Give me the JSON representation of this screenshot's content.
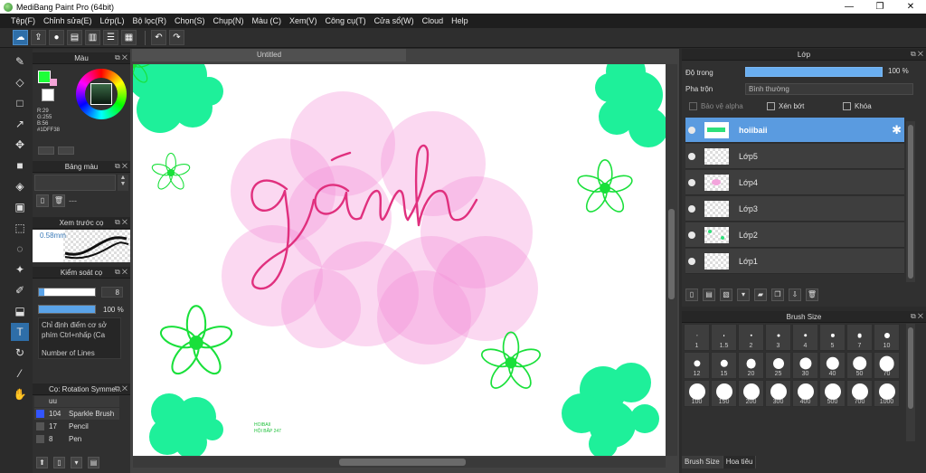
{
  "window": {
    "title": "MediBang Paint Pro (64bit)",
    "controls": [
      "—",
      "❐",
      "✕"
    ]
  },
  "menu": [
    "Tệp(F)",
    "Chỉnh sửa(E)",
    "Lớp(L)",
    "Bộ lọc(R)",
    "Chọn(S)",
    "Chụp(N)",
    "Màu (C)",
    "Xem(V)",
    "Công cụ(T)",
    "Cửa sổ(W)",
    "Cloud",
    "Help"
  ],
  "toolbar": {
    "undo": "↶",
    "redo": "↷"
  },
  "tools": [
    "brush-tool",
    "eraser-tool",
    "rectangle-tool",
    "select-tool",
    "move-tool",
    "fill-rect-tool",
    "bucket-tool",
    "gradient-tool",
    "marquee-tool",
    "lasso-tool",
    "magic-wand-tool",
    "select-pen-tool",
    "select-eraser-tool",
    "text-tool",
    "operation-tool",
    "dropper-tool",
    "hand-tool"
  ],
  "color_panel": {
    "title": "Màu",
    "r": "R:29",
    "g": "G:255",
    "b": "B:56",
    "hex": "#1DFF38",
    "primary_color": "#1DFF38"
  },
  "palette_panel": {
    "title": "Bảng màu",
    "placeholder": "---"
  },
  "brush_preview": {
    "title": "Xem trước cọ",
    "size": "0.58mm"
  },
  "brush_control": {
    "title": "Kiểm soát cọ",
    "size_value": "8",
    "opacity_value": "100 %",
    "desc_line1": "Chỉ định điểm cơ sở",
    "desc_line2": "phím Ctrl+nhấp (Ca",
    "lines_label": "Number of Lines"
  },
  "brush_list": {
    "title": "Cọ: Rotation Symme...",
    "group": "uu",
    "items": [
      {
        "num": "104",
        "name": "Sparkle Brush",
        "color": "#3355ff"
      },
      {
        "num": "17",
        "name": "Pencil",
        "color": "#444444"
      },
      {
        "num": "8",
        "name": "Pen",
        "color": "#444444"
      }
    ]
  },
  "document": {
    "tab": "Untitled",
    "canvas_text": "gánh",
    "signature_line1": "HOIBAII",
    "signature_line2": "HỘI BẮP 247"
  },
  "layer_panel": {
    "title": "Lớp",
    "opacity_label": "Độ trong",
    "opacity_value": "100 %",
    "opacity_fraction": 1.0,
    "blend_label": "Pha trộn",
    "blend_value": "Bình thường",
    "protect_alpha": "Bảo vệ alpha",
    "clipping": "Xén bớt",
    "lock": "Khóa",
    "layers": [
      {
        "name": "hoiibaii",
        "selected": true
      },
      {
        "name": "Lớp5",
        "selected": false
      },
      {
        "name": "Lớp4",
        "selected": false
      },
      {
        "name": "Lớp3",
        "selected": false
      },
      {
        "name": "Lớp2",
        "selected": false
      },
      {
        "name": "Lớp1",
        "selected": false
      }
    ]
  },
  "brush_size_panel": {
    "title": "Brush Size",
    "sizes": [
      "1",
      "1.5",
      "2",
      "3",
      "4",
      "5",
      "7",
      "10",
      "12",
      "15",
      "20",
      "25",
      "30",
      "40",
      "50",
      "70",
      "100",
      "150",
      "200",
      "300",
      "400",
      "500",
      "700",
      "1000"
    ],
    "tabs": [
      "Brush Size",
      "Hoa tiêu"
    ]
  }
}
